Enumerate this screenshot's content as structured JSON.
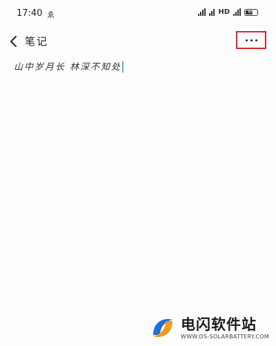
{
  "status_bar": {
    "time": "17:40",
    "notification": "ゑ",
    "network": "HD",
    "battery_text": "60",
    "battery_level": 0.6
  },
  "header": {
    "title": "笔记"
  },
  "note": {
    "text": "山中岁月长 林深不知处"
  },
  "watermark": {
    "title": "电闪软件站",
    "url": "WWW.DS-SOLARBATTERY.COM"
  },
  "colors": {
    "highlight_border": "#d6232b",
    "cursor": "#5bb8b0",
    "logo_blue": "#1e6fd9",
    "logo_orange": "#f39a1e"
  },
  "icons": {
    "back": "chevron-left-icon",
    "more": "more-dots-icon"
  }
}
